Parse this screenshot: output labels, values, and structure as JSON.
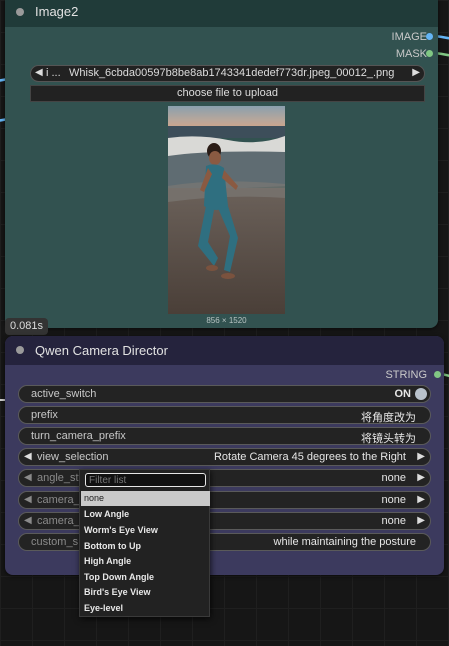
{
  "image_node": {
    "title": "Image2",
    "outputs": [
      {
        "label": "IMAGE",
        "color": "#64b5f6"
      },
      {
        "label": "MASK",
        "color": "#81c784"
      }
    ],
    "image_selector": {
      "prev_glyph": "◀",
      "index_text": "i ...",
      "filename": "Whisk_6cbda00597b8be8ab1743341dedef773dr.jpeg_00012_.png",
      "next_glyph": "▶"
    },
    "upload_button": "choose file to upload",
    "image_dimensions": "856 × 1520"
  },
  "exec_time_badge": "0.081s",
  "camera_node": {
    "title": "Qwen Camera Director",
    "output": {
      "label": "STRING",
      "color": "#81c784"
    },
    "widgets": [
      {
        "name": "active_switch",
        "value": "ON",
        "kind": "toggle"
      },
      {
        "name": "prefix",
        "value": "将角度改为",
        "kind": "text"
      },
      {
        "name": "turn_camera_prefix",
        "value": "将镜头转为",
        "kind": "text"
      },
      {
        "name": "view_selection",
        "value": "Rotate Camera 45 degrees to the Right",
        "kind": "combo"
      },
      {
        "name": "angle_sty",
        "value": "none",
        "kind": "combo"
      },
      {
        "name": "camera_",
        "value": "none",
        "kind": "combo"
      },
      {
        "name": "camera_",
        "value": "none",
        "kind": "combo"
      },
      {
        "name": "custom_s",
        "value": "while maintaining the posture",
        "kind": "text"
      }
    ]
  },
  "dropdown": {
    "filter_placeholder": "Filter list",
    "items": [
      "none",
      "Low Angle",
      "Worm's Eye View",
      "Bottom to Up",
      "High Angle",
      "Top Down Angle",
      "Bird's Eye View",
      "Eye-level"
    ],
    "selected": "none"
  },
  "colors": {
    "image_node_body": "#325250",
    "image_node_header": "#203b39",
    "camera_node_body": "#3c3a5e",
    "camera_node_header": "#25233d",
    "link_blue": "#64b5f6",
    "link_green": "#81c784"
  }
}
